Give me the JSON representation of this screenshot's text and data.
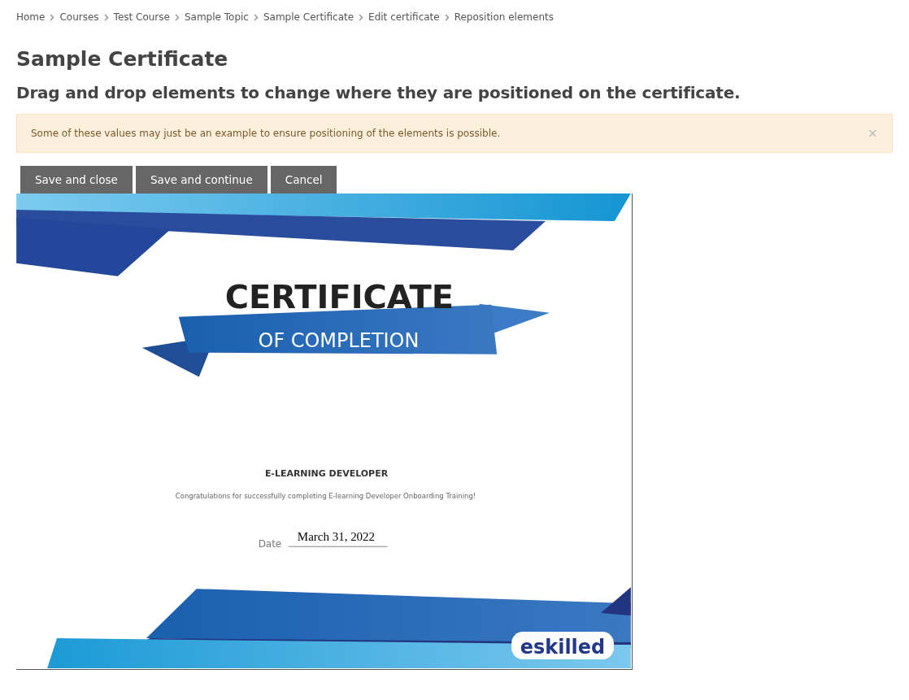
{
  "breadcrumbs": [
    {
      "label": "Home"
    },
    {
      "label": "Courses"
    },
    {
      "label": "Test Course"
    },
    {
      "label": "Sample Topic"
    },
    {
      "label": "Sample Certificate"
    },
    {
      "label": "Edit certificate"
    },
    {
      "label": "Reposition elements"
    }
  ],
  "title": "Sample Certificate",
  "subtitle": "Drag and drop elements to change where they are positioned on the certificate.",
  "alert": {
    "text": "Some of these values may just be an example to ensure positioning of the elements is possible.",
    "close": "×"
  },
  "buttons": [
    {
      "label": "Save and close"
    },
    {
      "label": "Save and continue"
    },
    {
      "label": "Cancel"
    }
  ],
  "certificate": {
    "heading": "CERTIFICATE",
    "ribbon": "OF COMPLETION",
    "role": "E-LEARNING DEVELOPER",
    "message": "Congratulations for successfully completing E-learning Developer Onboarding Training!",
    "date_label": "Date",
    "date_value": "March 31, 2022",
    "logo": "eskilled"
  }
}
